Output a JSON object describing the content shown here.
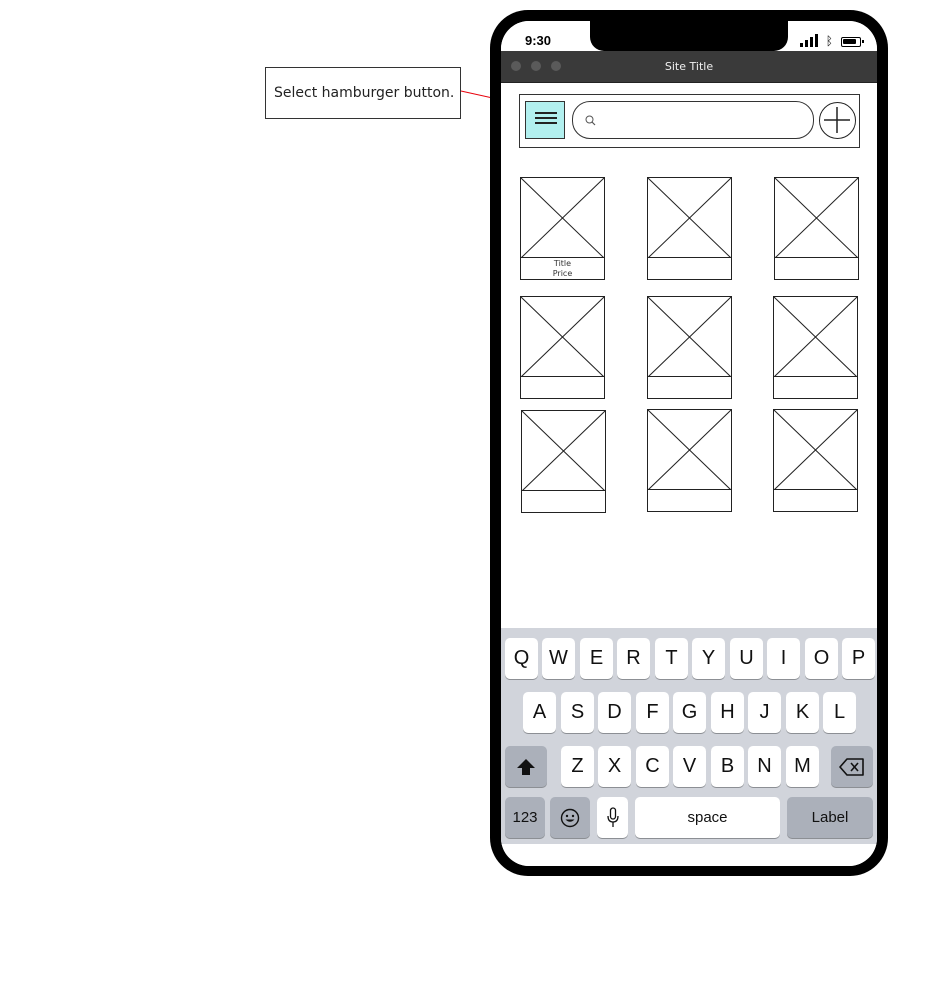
{
  "annotation": {
    "callout_text": "Select hamburger button.",
    "arrow_color": "#e8000b"
  },
  "status_bar": {
    "time": "9:30",
    "icons": [
      "signal-icon",
      "bluetooth-icon",
      "battery-icon"
    ]
  },
  "browser": {
    "site_title": "Site Title"
  },
  "header": {
    "menu_icon": "hamburger-icon",
    "menu_highlight_color": "#b2f0ef",
    "search": {
      "value": "",
      "placeholder": ""
    },
    "add_icon": "plus-circle-icon"
  },
  "grid": {
    "items": [
      {
        "title": "Title",
        "price": "Price"
      },
      {
        "title": "",
        "price": ""
      },
      {
        "title": "",
        "price": ""
      },
      {
        "title": "",
        "price": ""
      },
      {
        "title": "",
        "price": ""
      },
      {
        "title": "",
        "price": ""
      },
      {
        "title": "",
        "price": ""
      },
      {
        "title": "",
        "price": ""
      },
      {
        "title": "",
        "price": ""
      }
    ]
  },
  "keyboard": {
    "row1": [
      "Q",
      "W",
      "E",
      "R",
      "T",
      "Y",
      "U",
      "I",
      "O",
      "P"
    ],
    "row2": [
      "A",
      "S",
      "D",
      "F",
      "G",
      "H",
      "J",
      "K",
      "L"
    ],
    "row3": [
      "Z",
      "X",
      "C",
      "V",
      "B",
      "N",
      "M"
    ],
    "numbers_key": "123",
    "space_key": "space",
    "return_key": "Label",
    "shift_icon": "shift-icon",
    "delete_icon": "delete-icon",
    "emoji_icon": "emoji-icon",
    "mic_icon": "microphone-icon"
  }
}
